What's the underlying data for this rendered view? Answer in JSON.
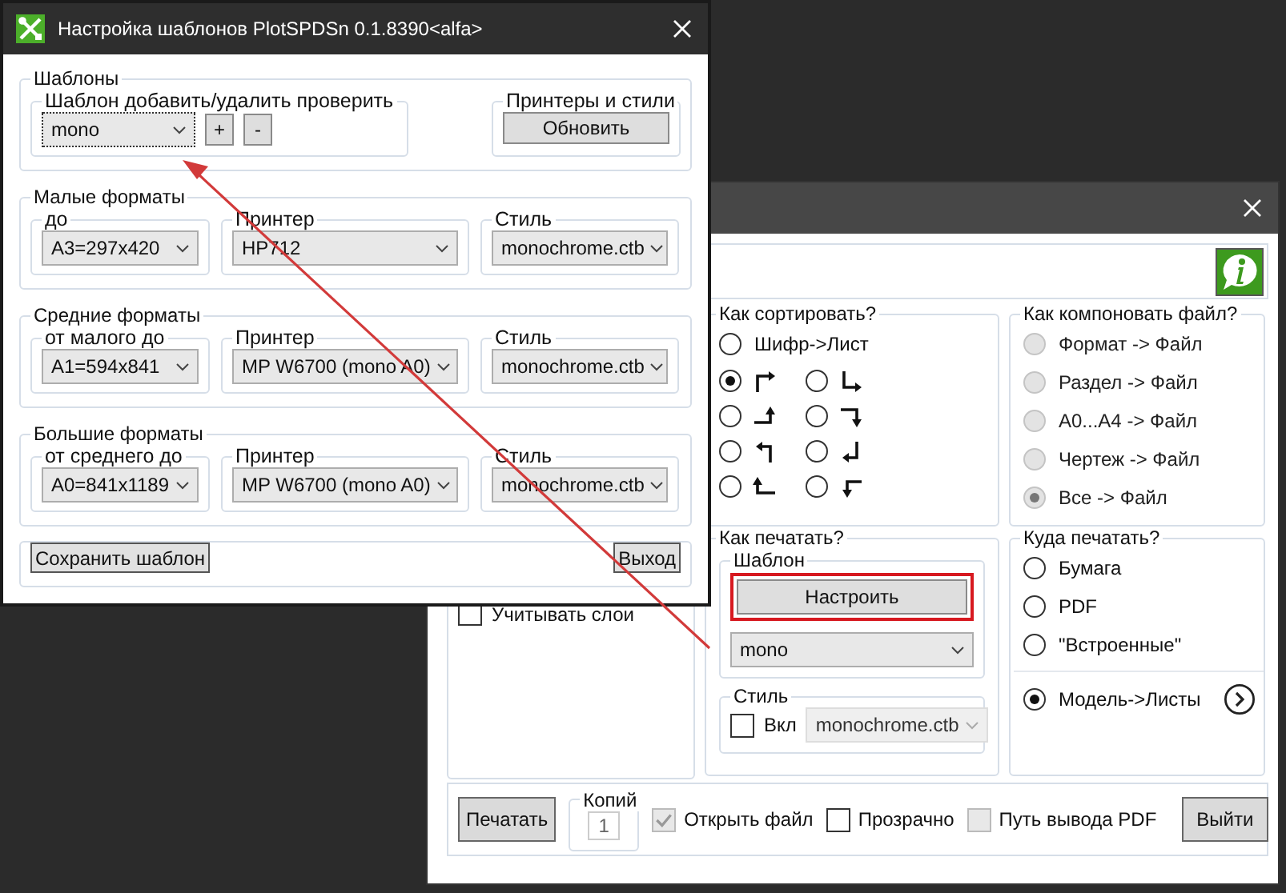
{
  "settings_window": {
    "title": "Настройка шаблонов PlotSPDSn 0.1.8390<alfa>",
    "templates": {
      "title": "Шаблоны",
      "manage": {
        "label": "Шаблон добавить/удалить проверить",
        "value": "mono",
        "add": "+",
        "remove": "-"
      },
      "printers": {
        "label": "Принтеры и стили",
        "button": "Обновить"
      }
    },
    "format_groups": [
      {
        "title": "Малые форматы",
        "size": {
          "label": "до",
          "value": "A3=297x420"
        },
        "printer": {
          "label": "Принтер",
          "value": "HP712"
        },
        "style": {
          "label": "Стиль",
          "value": "monochrome.ctb"
        }
      },
      {
        "title": "Средние форматы",
        "size": {
          "label": "от малого до",
          "value": "A1=594x841"
        },
        "printer": {
          "label": "Принтер",
          "value": "MP W6700 (mono A0)"
        },
        "style": {
          "label": "Стиль",
          "value": "monochrome.ctb"
        }
      },
      {
        "title": "Большие форматы",
        "size": {
          "label": "от среднего до",
          "value": "A0=841x1189"
        },
        "printer": {
          "label": "Принтер",
          "value": "MP W6700 (mono A0)"
        },
        "style": {
          "label": "Стиль",
          "value": "monochrome.ctb"
        }
      }
    ],
    "save": "Сохранить шаблон",
    "exit": "Выход"
  },
  "print_window": {
    "layers": {
      "label": "Учитывать слои",
      "checked": false
    },
    "sorting": {
      "title": "Как сортировать?",
      "options": [
        {
          "kind": "text",
          "label": "Шифр->Лист",
          "selected": false
        },
        {
          "kind": "icon",
          "selected": true
        },
        {
          "kind": "icon",
          "selected": false
        },
        {
          "kind": "icon",
          "selected": false
        },
        {
          "kind": "icon",
          "selected": false
        },
        {
          "kind": "icon",
          "selected": false
        },
        {
          "kind": "icon",
          "selected": false
        },
        {
          "kind": "icon",
          "selected": false
        },
        {
          "kind": "icon",
          "selected": false
        }
      ]
    },
    "layout": {
      "title": "Как компоновать файл?",
      "options": [
        {
          "label": "Формат -> Файл",
          "selected": false,
          "disabled": true
        },
        {
          "label": "Раздел -> Файл",
          "selected": false,
          "disabled": true
        },
        {
          "label": "A0...A4 -> Файл",
          "selected": false,
          "disabled": true
        },
        {
          "label": "Чертеж -> Файл",
          "selected": false,
          "disabled": true
        },
        {
          "label": "Все -> Файл",
          "selected": true,
          "disabled": true
        }
      ]
    },
    "print_mode": {
      "title": "Как печатать?",
      "template": {
        "title": "Шаблон",
        "button": "Настроить",
        "value": "mono"
      },
      "style": {
        "title": "Стиль",
        "enable": {
          "label": "Вкл",
          "checked": false
        },
        "value": "monochrome.ctb",
        "disabled": true
      }
    },
    "destination": {
      "title": "Куда печатать?",
      "options": [
        {
          "kind": "plain",
          "label": "Бумага",
          "selected": false
        },
        {
          "kind": "plain",
          "label": "PDF",
          "selected": false
        },
        {
          "kind": "plain",
          "label": "\"Встроенные\"",
          "selected": false
        },
        {
          "kind": "more",
          "label": "Модель->Листы",
          "selected": true
        }
      ]
    },
    "bottom": {
      "print": "Печатать",
      "copies": {
        "label": "Копий",
        "value": "1"
      },
      "options": [
        {
          "label": "Открыть файл",
          "checked": true,
          "disabled": true
        },
        {
          "label": "Прозрачно",
          "checked": false,
          "disabled": false
        },
        {
          "label": "Путь вывода PDF",
          "checked": false,
          "disabled": true
        }
      ],
      "exit": "Выйти"
    }
  }
}
